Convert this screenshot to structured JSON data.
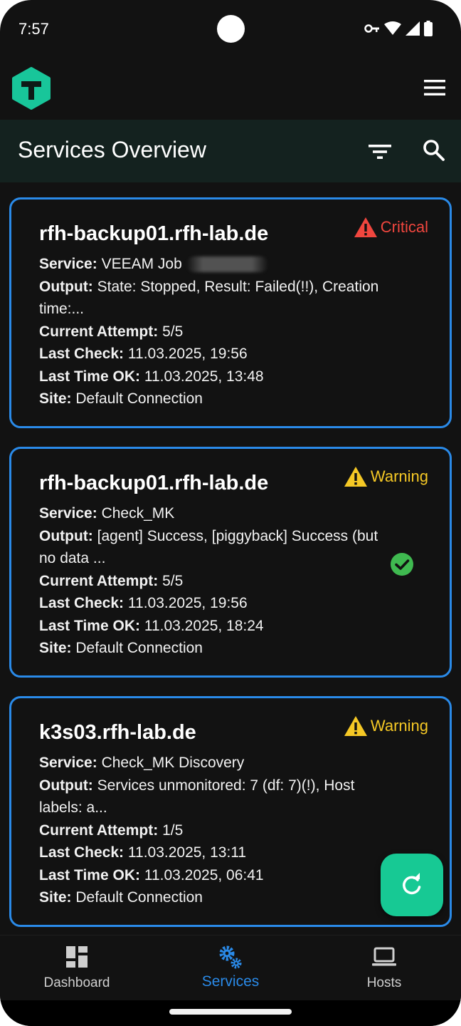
{
  "status_bar": {
    "time": "7:57"
  },
  "header": {
    "title": "Services Overview"
  },
  "labels": {
    "service": "Service:",
    "output": "Output:",
    "current_attempt": "Current Attempt:",
    "last_check": "Last Check:",
    "last_time_ok": "Last Time OK:",
    "site": "Site:"
  },
  "services": [
    {
      "host": "rfh-backup01.rfh-lab.de",
      "state": "Critical",
      "service": "VEEAM Job",
      "output": "State: Stopped, Result: Failed(!!), Creation time:...",
      "current_attempt": "5/5",
      "last_check": "11.03.2025, 19:56",
      "last_time_ok": "11.03.2025, 13:48",
      "site": "Default Connection",
      "acknowledged": false
    },
    {
      "host": "rfh-backup01.rfh-lab.de",
      "state": "Warning",
      "service": "Check_MK",
      "output": "[agent] Success, [piggyback] Success (but no data ...",
      "current_attempt": "5/5",
      "last_check": "11.03.2025, 19:56",
      "last_time_ok": "11.03.2025, 18:24",
      "site": "Default Connection",
      "acknowledged": true
    },
    {
      "host": "k3s03.rfh-lab.de",
      "state": "Warning",
      "service": "Check_MK Discovery",
      "output": "Services unmonitored: 7 (df: 7)(!), Host labels: a...",
      "current_attempt": "1/5",
      "last_check": "11.03.2025, 13:11",
      "last_time_ok": "11.03.2025, 06:41",
      "site": "Default Connection",
      "acknowledged": false
    }
  ],
  "bottom_nav": {
    "items": [
      {
        "label": "Dashboard",
        "icon": "dashboard-icon",
        "active": false
      },
      {
        "label": "Services",
        "icon": "gears-icon",
        "active": true
      },
      {
        "label": "Hosts",
        "icon": "laptop-icon",
        "active": false
      }
    ]
  },
  "colors": {
    "accent": "#2a8ae8",
    "critical": "#f0463e",
    "warning": "#f5c825",
    "ok": "#3fb950",
    "fab": "#17c994",
    "logo": "#18c69a"
  }
}
